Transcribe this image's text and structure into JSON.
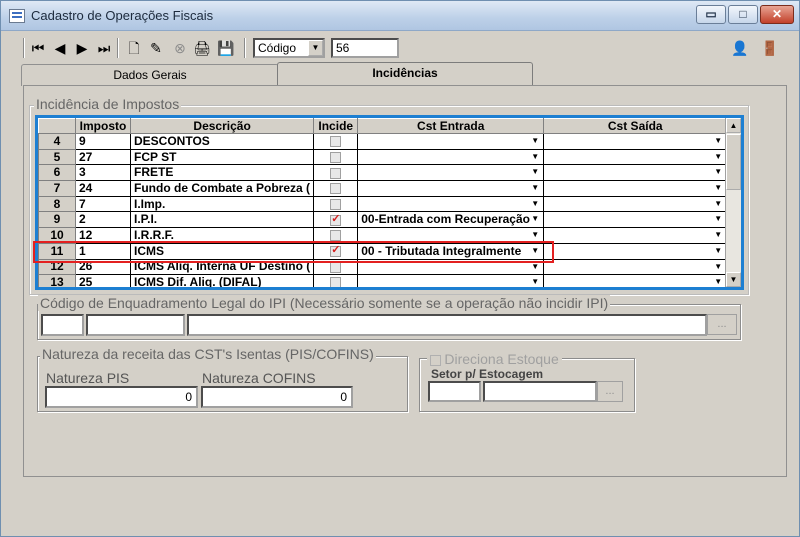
{
  "window": {
    "title": "Cadastro de Operações Fiscais",
    "buttons": [
      "▭",
      "□",
      "✕"
    ]
  },
  "toolbar": {
    "nav_icons": [
      "⏮",
      "◀",
      "▶",
      "⏭"
    ],
    "action_icons": [
      "🗋",
      "✎",
      "⊗",
      "🖨",
      "💾"
    ],
    "search_field": "Código",
    "search_value": "56",
    "right_icons": [
      "👤",
      "🚪"
    ]
  },
  "tabs": [
    {
      "label": "Dados Gerais"
    },
    {
      "label": "Incidências"
    }
  ],
  "incidencia": {
    "group_label": "Incidência de Impostos",
    "columns": [
      "Imposto",
      "Descrição",
      "Incide",
      "Cst Entrada",
      "Cst Saída"
    ],
    "rows": [
      {
        "num": "4",
        "imposto": "9",
        "descricao": "DESCONTOS",
        "incide": false,
        "cst_entrada": "",
        "cst_saida": ""
      },
      {
        "num": "5",
        "imposto": "27",
        "descricao": "FCP ST",
        "incide": false,
        "cst_entrada": "",
        "cst_saida": ""
      },
      {
        "num": "6",
        "imposto": "3",
        "descricao": "FRETE",
        "incide": false,
        "cst_entrada": "",
        "cst_saida": ""
      },
      {
        "num": "7",
        "imposto": "24",
        "descricao": "Fundo de Combate a Pobreza (",
        "incide": false,
        "cst_entrada": "",
        "cst_saida": ""
      },
      {
        "num": "8",
        "imposto": "7",
        "descricao": "I.Imp.",
        "incide": false,
        "cst_entrada": "",
        "cst_saida": ""
      },
      {
        "num": "9",
        "imposto": "2",
        "descricao": "I.P.I.",
        "incide": true,
        "cst_entrada": "00-Entrada com Recuperação",
        "cst_saida": ""
      },
      {
        "num": "10",
        "imposto": "12",
        "descricao": "I.R.R.F.",
        "incide": false,
        "cst_entrada": "",
        "cst_saida": ""
      },
      {
        "num": "11",
        "imposto": "1",
        "descricao": "ICMS",
        "incide": true,
        "cst_entrada": "00 - Tributada Integralmente",
        "cst_saida": ""
      },
      {
        "num": "12",
        "imposto": "26",
        "descricao": "ICMS Aliq. Interna UF Destino (",
        "incide": false,
        "cst_entrada": "",
        "cst_saida": ""
      },
      {
        "num": "13",
        "imposto": "25",
        "descricao": "ICMS Dif. Aliq. (DIFAL)",
        "incide": false,
        "cst_entrada": "",
        "cst_saida": ""
      }
    ]
  },
  "enquadramento": {
    "label": "Código de Enquadramento Legal do IPI (Necessário somente se a operação não incidir IPI)",
    "button": "..."
  },
  "natureza": {
    "label": "Natureza da receita das CST's Isentas (PIS/COFINS)",
    "pis_label": "Natureza PIS",
    "pis_value": "0",
    "cofins_label": "Natureza COFINS",
    "cofins_value": "0"
  },
  "estoque": {
    "label": "Direciona Estoque",
    "setor_label": "Setor p/ Estocagem",
    "button": "..."
  },
  "icons": {
    "checkbox_checked": "check-icon",
    "dropdown": "chevron-down-icon"
  }
}
